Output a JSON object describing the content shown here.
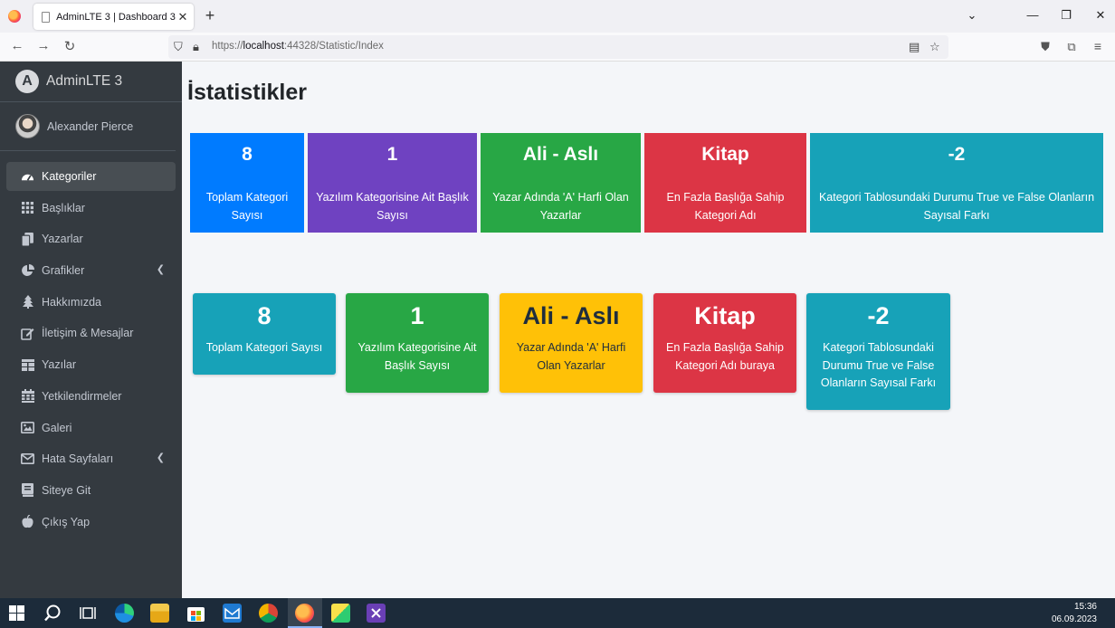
{
  "browser": {
    "tab_title": "AdminLTE 3 | Dashboard 3",
    "close_glyph": "✕",
    "new_tab_glyph": "+",
    "url_prefix": "https://",
    "url_host": "localhost",
    "url_rest": ":44328/Statistic/Index"
  },
  "sidebar": {
    "brand_letter": "A",
    "brand": "AdminLTE 3",
    "user": "Alexander Pierce",
    "items": [
      {
        "label": "Kategoriler",
        "icon": "tachometer-icon"
      },
      {
        "label": "Başlıklar",
        "icon": "grid-icon"
      },
      {
        "label": "Yazarlar",
        "icon": "copy-icon"
      },
      {
        "label": "Grafikler",
        "icon": "pie-chart-icon"
      },
      {
        "label": "Hakkımızda",
        "icon": "tree-icon"
      },
      {
        "label": "İletişim & Mesajlar",
        "icon": "edit-icon"
      },
      {
        "label": "Yazılar",
        "icon": "table-icon"
      },
      {
        "label": "Yetkilendirmeler",
        "icon": "calendar-icon"
      },
      {
        "label": "Galeri",
        "icon": "image-icon"
      },
      {
        "label": "Hata Sayfaları",
        "icon": "envelope-icon"
      },
      {
        "label": "Siteye Git",
        "icon": "book-icon"
      },
      {
        "label": "Çıkış Yap",
        "icon": "apple-icon"
      }
    ]
  },
  "main": {
    "title": "İstatistikler",
    "row1": [
      {
        "value": "8",
        "label": "Toplam Kategori Sayısı",
        "color": "#007bff"
      },
      {
        "value": "1",
        "label": "Yazılım Kategorisine Ait Başlık Sayısı",
        "color": "#6f42c1"
      },
      {
        "value": "Ali - Aslı",
        "label": "Yazar Adında 'A' Harfi Olan Yazarlar",
        "color": "#28a745"
      },
      {
        "value": "Kitap",
        "label": "En Fazla Başlığa Sahip Kategori Adı",
        "color": "#dc3545"
      },
      {
        "value": "-2",
        "label": "Kategori Tablosundaki Durumu True ve False Olanların Sayısal Farkı",
        "color": "#17a2b8"
      }
    ],
    "row2": [
      {
        "value": "8",
        "label": "Toplam Kategori Sayısı",
        "color": "#17a2b8"
      },
      {
        "value": "1",
        "label": "Yazılım Kategorisine Ait Başlık Sayısı",
        "color": "#28a745"
      },
      {
        "value": "Ali - Aslı",
        "label": "Yazar Adında 'A' Harfi Olan Yazarlar",
        "color": "#ffc107"
      },
      {
        "value": "Kitap",
        "label": "En Fazla Başlığa Sahip Kategori Adı buraya",
        "color": "#dc3545"
      },
      {
        "value": "-2",
        "label": "Kategori Tablosundaki Durumu True ve False Olanların Sayısal Farkı",
        "color": "#17a2b8"
      }
    ]
  },
  "taskbar": {
    "time": "15:36",
    "date": "06.09.2023"
  }
}
